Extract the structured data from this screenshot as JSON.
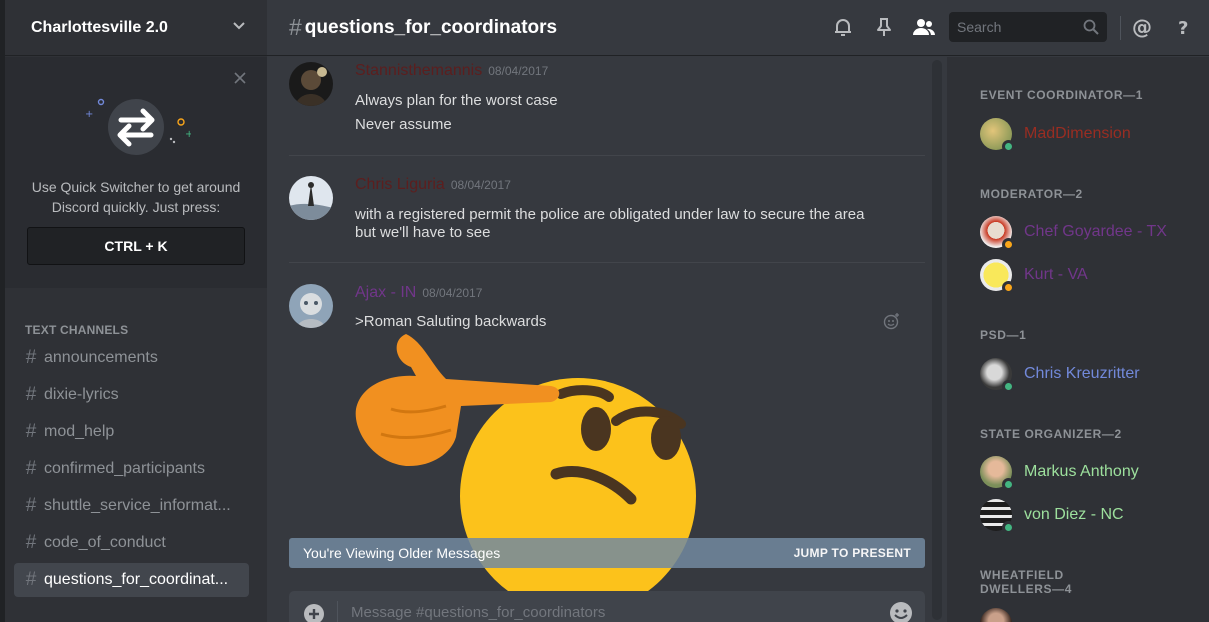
{
  "server": {
    "name": "Charlottesville 2.0"
  },
  "quick_switcher": {
    "tip": "Use Quick Switcher to get around Discord quickly. Just press:",
    "shortcut": "CTRL + K"
  },
  "channels": {
    "category": "TEXT CHANNELS",
    "items": [
      {
        "name": "announcements"
      },
      {
        "name": "dixie-lyrics"
      },
      {
        "name": "mod_help"
      },
      {
        "name": "confirmed_participants"
      },
      {
        "name": "shuttle_service_informat..."
      },
      {
        "name": "code_of_conduct"
      },
      {
        "name": "questions_for_coordinat...",
        "active": true
      }
    ]
  },
  "header": {
    "hash": "#",
    "channel_name": "questions_for_coordinators",
    "search_placeholder": "Search",
    "icons": [
      "bell-icon",
      "pin-icon",
      "members-icon",
      "search-icon",
      "mention-icon",
      "help-icon"
    ]
  },
  "messages": [
    {
      "author": "Stannisthemannis",
      "color": "#5c1e1e",
      "timestamp": "08/04/2017",
      "lines": [
        "Always plan for the worst case",
        "Never assume"
      ]
    },
    {
      "author": "Chris Liguria",
      "color": "#5c1e1e",
      "timestamp": "08/04/2017",
      "lines": [
        "with a registered permit the police are obligated under law to secure the area",
        "but we'll have to see"
      ]
    },
    {
      "author": "Ajax - IN",
      "color": "#71368a",
      "timestamp": "08/04/2017",
      "lines": [
        ">Roman Saluting backwards"
      ]
    }
  ],
  "older_bar": {
    "text": "You're Viewing Older Messages",
    "jump": "JUMP TO PRESENT"
  },
  "composer": {
    "placeholder": "Message #questions_for_coordinators"
  },
  "members": {
    "roles": [
      {
        "label": "EVENT COORDINATOR—1",
        "members": [
          {
            "name": "MadDimension",
            "color": "#992d22",
            "status": "online"
          }
        ]
      },
      {
        "label": "MODERATOR—2",
        "members": [
          {
            "name": "Chef Goyardee - TX",
            "color": "#71368a",
            "status": "idle"
          },
          {
            "name": "Kurt - VA",
            "color": "#71368a",
            "status": "idle"
          }
        ]
      },
      {
        "label": "PSD—1",
        "members": [
          {
            "name": "Chris Kreuzritter",
            "color": "#7289da",
            "status": "online"
          }
        ]
      },
      {
        "label": "STATE ORGANIZER—2",
        "members": [
          {
            "name": "Markus Anthony",
            "color": "#9de09d",
            "status": "online"
          },
          {
            "name": "von Diez - NC",
            "color": "#9de09d",
            "status": "online"
          }
        ]
      },
      {
        "label": "WHEATFIELD DWELLERS—4",
        "members": []
      }
    ]
  },
  "colors": {
    "online": "#43b581",
    "idle": "#faa61a",
    "accent": "#7289da"
  }
}
